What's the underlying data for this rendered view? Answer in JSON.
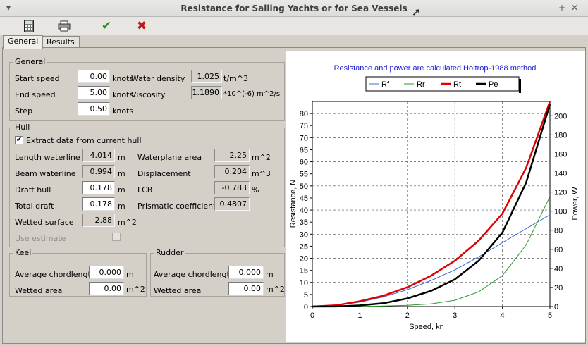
{
  "window": {
    "title": "Resistance for Sailing Yachts or for Sea Vessels"
  },
  "tabs": [
    "General",
    "Results"
  ],
  "general": {
    "title": "General",
    "start_speed": {
      "label": "Start speed",
      "value": "0.00",
      "unit": "knots"
    },
    "end_speed": {
      "label": "End speed",
      "value": "5.00",
      "unit": "knots"
    },
    "step": {
      "label": "Step",
      "value": "0.50",
      "unit": "knots"
    },
    "water_density": {
      "label": "Water density",
      "value": "1.025",
      "unit": "t/m^3"
    },
    "viscosity": {
      "label": "Viscosity",
      "value": "1.1890",
      "unit": "*10^(-6) m^2/s"
    }
  },
  "hull": {
    "title": "Hull",
    "extract_label": "Extract data from current hull",
    "extract_checked": true,
    "length_waterline": {
      "label": "Length waterline",
      "value": "4.014",
      "unit": "m"
    },
    "beam_waterline": {
      "label": "Beam waterline",
      "value": "0.994",
      "unit": "m"
    },
    "draft_hull": {
      "label": "Draft hull",
      "value": "0.178",
      "unit": "m"
    },
    "total_draft": {
      "label": "Total draft",
      "value": "0.178",
      "unit": "m"
    },
    "wetted_surface": {
      "label": "Wetted surface",
      "value": "2.88",
      "unit": "m^2"
    },
    "waterplane_area": {
      "label": "Waterplane area",
      "value": "2.25",
      "unit": "m^2"
    },
    "displacement": {
      "label": "Displacement",
      "value": "0.204",
      "unit": "m^3"
    },
    "lcb": {
      "label": "LCB",
      "value": "-0.783",
      "unit": "%"
    },
    "prismatic": {
      "label": "Prismatic coefficient",
      "value": "0.4807"
    },
    "use_estimate": {
      "label": "Use estimate",
      "checked": false
    }
  },
  "keel": {
    "title": "Keel",
    "avg_chord": {
      "label": "Average chordlength",
      "value": "0.000",
      "unit": "m"
    },
    "wetted_area": {
      "label": "Wetted area",
      "value": "0.00",
      "unit": "m^2"
    }
  },
  "rudder": {
    "title": "Rudder",
    "avg_chord": {
      "label": "Average chordlength",
      "value": "0.000",
      "unit": "m"
    },
    "wetted_area": {
      "label": "Wetted area",
      "value": "0.00",
      "unit": "m^2"
    }
  },
  "icons": [
    "calculator-icon",
    "printer-icon",
    "checkmark-icon",
    "cross-icon"
  ],
  "colors": {
    "rf": "#3a6bd8",
    "rr": "#2e9a2e",
    "rt": "#e00000",
    "pe": "#000000",
    "title": "#1c1cd0"
  },
  "chart_data": {
    "type": "line",
    "title": "Resistance and power are calculated Holtrop-1988 method",
    "xlabel": "Speed, kn",
    "ylabel": "Resistance, N",
    "y2label": "Power, W",
    "xlim": [
      0,
      5
    ],
    "ylim": [
      0,
      85
    ],
    "y2lim": [
      0,
      215
    ],
    "xticks": [
      0,
      1,
      2,
      3,
      4,
      5
    ],
    "yticks": [
      0,
      5,
      10,
      15,
      20,
      25,
      30,
      35,
      40,
      45,
      50,
      55,
      60,
      65,
      70,
      75,
      80
    ],
    "y2ticks": [
      0,
      20,
      40,
      60,
      80,
      100,
      120,
      140,
      160,
      180,
      200
    ],
    "grid": true,
    "legend_position": "top",
    "x": [
      0,
      0.5,
      1,
      1.5,
      2,
      2.5,
      3,
      3.5,
      4,
      4.5,
      5
    ],
    "series": [
      {
        "name": "Rf",
        "axis": "left",
        "values": [
          0,
          0.5,
          1.8,
          4,
          7,
          10.8,
          15.2,
          20.6,
          26.5,
          32.3,
          38
        ]
      },
      {
        "name": "Rr",
        "axis": "left",
        "values": [
          0,
          0,
          0.05,
          0.2,
          0.5,
          1.1,
          2.6,
          6.1,
          12.8,
          25.6,
          45.5
        ]
      },
      {
        "name": "Rt",
        "axis": "left",
        "values": [
          0,
          0.5,
          2.2,
          4.5,
          8,
          12.8,
          19,
          27.3,
          38.5,
          57.5,
          85
        ]
      },
      {
        "name": "Pe",
        "axis": "right",
        "values": [
          0,
          0.1,
          1.2,
          3.5,
          8.5,
          16.5,
          28.5,
          48,
          77.5,
          130,
          212
        ]
      }
    ]
  }
}
